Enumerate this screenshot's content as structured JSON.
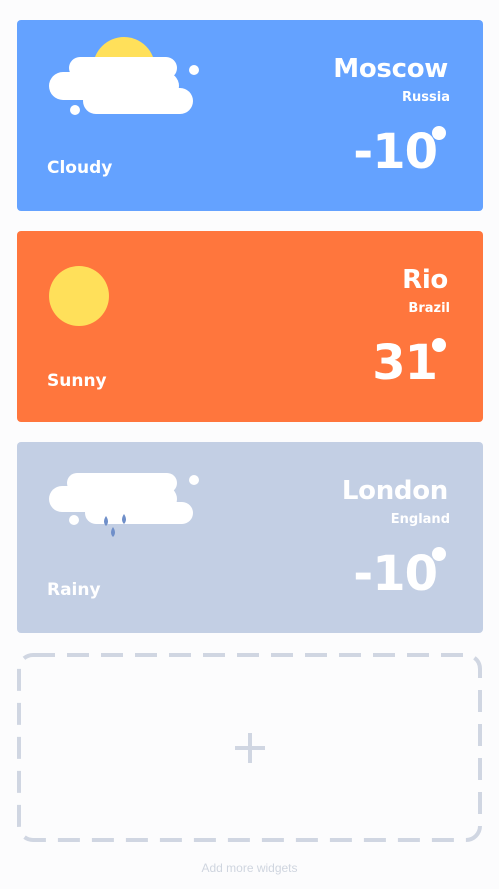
{
  "cards": [
    {
      "city": "Moscow",
      "country": "Russia",
      "temperature": "-10",
      "condition": "Cloudy",
      "icon": "cloudy-icon",
      "background": "#64a2ff"
    },
    {
      "city": "Rio",
      "country": "Brazil",
      "temperature": "31",
      "condition": "Sunny",
      "icon": "sun-icon",
      "background": "#ff763d"
    },
    {
      "city": "London",
      "country": "England",
      "temperature": "-10",
      "condition": "Rainy",
      "icon": "rainy-icon",
      "background": "#c3cfe4"
    }
  ],
  "add_widget": {
    "icon": "plus-icon",
    "label": "Add more widgets"
  },
  "colors": {
    "sun": "#ffe05a",
    "cloud": "#ffffff",
    "rain_drop": "#6f8fc9",
    "dashed_border": "#d0d6e2"
  }
}
